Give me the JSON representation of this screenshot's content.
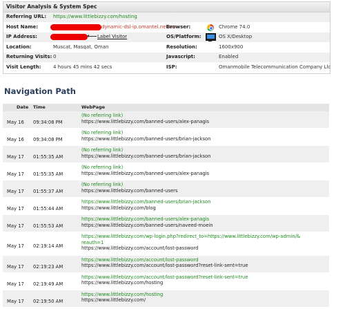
{
  "spec": {
    "title": "Visitor Analysis & System Spec",
    "referring_url": {
      "label": "Referring URL:",
      "value": "https://www.littlebizzy.com/hosting"
    },
    "host_name": {
      "label": "Host Name:",
      "tail": "dynamic-dsl-ip.omantel.net.om"
    },
    "browser": {
      "label": "Browser:",
      "value": "Chrome 74.0",
      "icon": "chrome-icon"
    },
    "ip_address": {
      "label": "IP Address:",
      "label_link": "Label Visitor"
    },
    "os": {
      "label": "OS/Platform:",
      "value": "OS X/Desktop",
      "icon": "monitor-icon"
    },
    "location": {
      "label": "Location:",
      "value": "Muscat, Masqat, Oman"
    },
    "resolution": {
      "label": "Resolution:",
      "value": "1600x900"
    },
    "returning": {
      "label": "Returning Visits:",
      "value": "0"
    },
    "javascript": {
      "label": "Javascript:",
      "value": "Enabled"
    },
    "visit_length": {
      "label": "Visit Length:",
      "value": "4 hours 45 mins 42 secs"
    },
    "isp": {
      "label": "ISP:",
      "value": "Omanmobile Telecommunication Company Llc"
    }
  },
  "nav": {
    "title": "Navigation Path",
    "headers": {
      "date": "Date",
      "time": "Time",
      "page": "WebPage"
    },
    "rows": [
      {
        "date": "May 16",
        "time": "09:34:08 PM",
        "lines": [
          {
            "t": "(No referring link)",
            "c": "ref"
          },
          {
            "t": "https://www.littlebizzy.com/banned-users/alex-panagis",
            "c": "plain"
          }
        ]
      },
      {
        "date": "May 16",
        "time": "09:34:08 PM",
        "lines": [
          {
            "t": "(No referring link)",
            "c": "ref"
          },
          {
            "t": "https://www.littlebizzy.com/banned-users/brian-jackson",
            "c": "plain"
          }
        ]
      },
      {
        "date": "May 17",
        "time": "01:55:35 AM",
        "lines": [
          {
            "t": "(No referring link)",
            "c": "ref"
          },
          {
            "t": "https://www.littlebizzy.com/banned-users/brian-jackson",
            "c": "plain"
          }
        ]
      },
      {
        "date": "May 17",
        "time": "01:55:35 AM",
        "lines": [
          {
            "t": "(No referring link)",
            "c": "ref"
          },
          {
            "t": "https://www.littlebizzy.com/banned-users/alex-panagis",
            "c": "plain"
          }
        ]
      },
      {
        "date": "May 17",
        "time": "01:55:37 AM",
        "lines": [
          {
            "t": "(No referring link)",
            "c": "ref"
          },
          {
            "t": "https://www.littlebizzy.com/banned-users",
            "c": "plain"
          }
        ]
      },
      {
        "date": "May 17",
        "time": "01:55:44 AM",
        "lines": [
          {
            "t": "https://www.littlebizzy.com/banned-users/brian-jackson",
            "c": "green"
          },
          {
            "t": "https://www.littlebizzy.com/blog",
            "c": "plain"
          }
        ]
      },
      {
        "date": "May 17",
        "time": "01:55:53 AM",
        "lines": [
          {
            "t": "https://www.littlebizzy.com/banned-users/alex-panagis",
            "c": "green"
          },
          {
            "t": "https://www.littlebizzy.com/banned-users/naveed-moein",
            "c": "plain"
          }
        ]
      },
      {
        "date": "May 17",
        "time": "02:19:14 AM",
        "lines": [
          {
            "t": "https://www.littlebizzy.com/wp-login.php?redirect_to=https://www.littlebizzy.com/wp-admin/& reauth=1",
            "c": "green wrap"
          },
          {
            "t": "https://www.littlebizzy.com/account/lost-password",
            "c": "plain"
          }
        ]
      },
      {
        "date": "May 17",
        "time": "02:19:23 AM",
        "lines": [
          {
            "t": "https://www.littlebizzy.com/account/lost-password",
            "c": "green"
          },
          {
            "t": "https://www.littlebizzy.com/account/lost-password?reset-link-sent=true",
            "c": "plain"
          }
        ]
      },
      {
        "date": "May 17",
        "time": "02:19:49 AM",
        "lines": [
          {
            "t": "https://www.littlebizzy.com/account/lost-password?reset-link-sent=true",
            "c": "green"
          },
          {
            "t": "https://www.littlebizzy.com/hosting",
            "c": "plain"
          }
        ]
      },
      {
        "date": "May 17",
        "time": "02:19:50 AM",
        "lines": [
          {
            "t": "https://www.littlebizzy.com/hosting",
            "c": "green"
          },
          {
            "t": "https://www.littlebizzy.com/",
            "c": "plain"
          }
        ]
      }
    ]
  }
}
